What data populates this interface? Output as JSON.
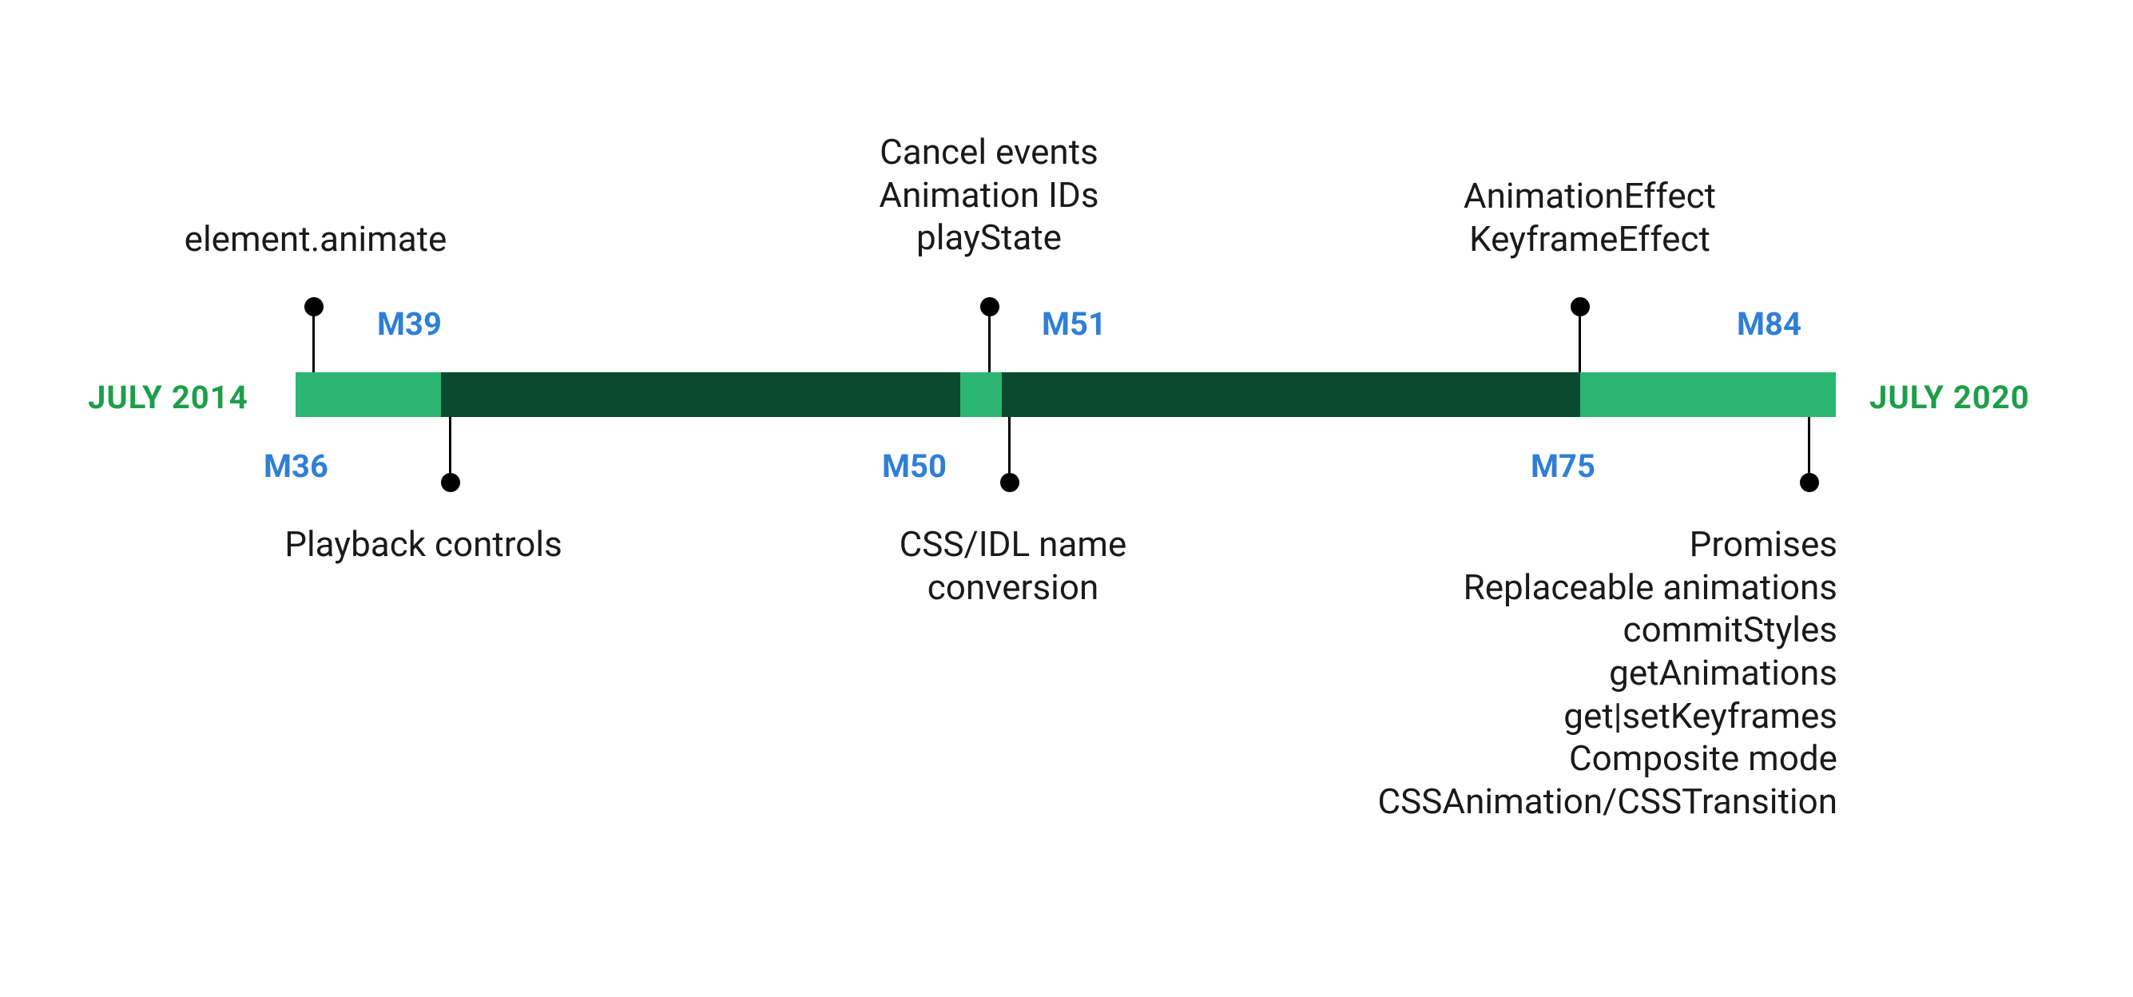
{
  "timeline": {
    "start_label": "JULY 2014",
    "end_label": "JULY 2020"
  },
  "markers": {
    "m36": "M36",
    "m39": "M39",
    "m50": "M50",
    "m51": "M51",
    "m75": "M75",
    "m84": "M84"
  },
  "notes": {
    "m36": "element.animate",
    "m39": "Playback controls",
    "m50": "CSS/IDL name\nconversion",
    "m51": "Cancel events\nAnimation IDs\nplayState",
    "m75": "AnimationEffect\nKeyframeEffect",
    "m84": "Promises\nReplaceable animations\ncommitStyles\ngetAnimations\nget|setKeyframes\nComposite mode\nCSSAnimation/CSSTransition"
  },
  "chart_data": {
    "type": "timeline",
    "title": "",
    "range": {
      "start": "2014-07",
      "end": "2020-07"
    },
    "events": [
      {
        "id": "M36",
        "side": "top",
        "features": [
          "element.animate"
        ]
      },
      {
        "id": "M39",
        "side": "bottom",
        "features": [
          "Playback controls"
        ]
      },
      {
        "id": "M50",
        "side": "bottom",
        "features": [
          "CSS/IDL name conversion"
        ]
      },
      {
        "id": "M51",
        "side": "top",
        "features": [
          "Cancel events",
          "Animation IDs",
          "playState"
        ]
      },
      {
        "id": "M75",
        "side": "top",
        "features": [
          "AnimationEffect",
          "KeyframeEffect"
        ]
      },
      {
        "id": "M84",
        "side": "bottom",
        "features": [
          "Promises",
          "Replaceable animations",
          "commitStyles",
          "getAnimations",
          "get|setKeyframes",
          "Composite mode",
          "CSSAnimation/CSSTransition"
        ]
      }
    ]
  }
}
